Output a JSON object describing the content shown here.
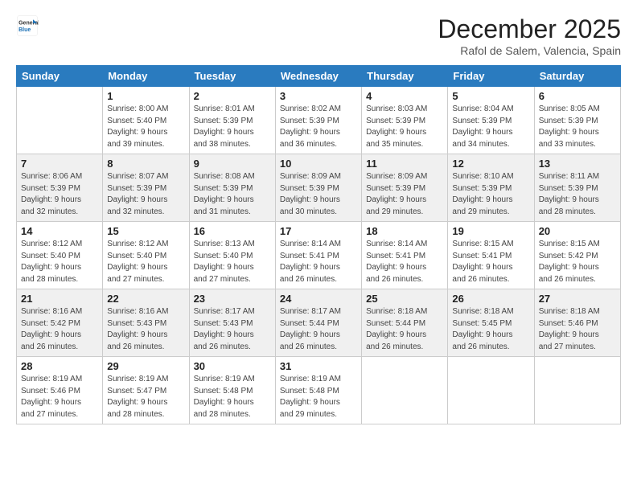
{
  "logo": {
    "line1": "General",
    "line2": "Blue"
  },
  "title": "December 2025",
  "subtitle": "Rafol de Salem, Valencia, Spain",
  "weekdays": [
    "Sunday",
    "Monday",
    "Tuesday",
    "Wednesday",
    "Thursday",
    "Friday",
    "Saturday"
  ],
  "weeks": [
    [
      {
        "day": "",
        "info": ""
      },
      {
        "day": "1",
        "info": "Sunrise: 8:00 AM\nSunset: 5:40 PM\nDaylight: 9 hours\nand 39 minutes."
      },
      {
        "day": "2",
        "info": "Sunrise: 8:01 AM\nSunset: 5:39 PM\nDaylight: 9 hours\nand 38 minutes."
      },
      {
        "day": "3",
        "info": "Sunrise: 8:02 AM\nSunset: 5:39 PM\nDaylight: 9 hours\nand 36 minutes."
      },
      {
        "day": "4",
        "info": "Sunrise: 8:03 AM\nSunset: 5:39 PM\nDaylight: 9 hours\nand 35 minutes."
      },
      {
        "day": "5",
        "info": "Sunrise: 8:04 AM\nSunset: 5:39 PM\nDaylight: 9 hours\nand 34 minutes."
      },
      {
        "day": "6",
        "info": "Sunrise: 8:05 AM\nSunset: 5:39 PM\nDaylight: 9 hours\nand 33 minutes."
      }
    ],
    [
      {
        "day": "7",
        "info": "Sunrise: 8:06 AM\nSunset: 5:39 PM\nDaylight: 9 hours\nand 32 minutes."
      },
      {
        "day": "8",
        "info": "Sunrise: 8:07 AM\nSunset: 5:39 PM\nDaylight: 9 hours\nand 32 minutes."
      },
      {
        "day": "9",
        "info": "Sunrise: 8:08 AM\nSunset: 5:39 PM\nDaylight: 9 hours\nand 31 minutes."
      },
      {
        "day": "10",
        "info": "Sunrise: 8:09 AM\nSunset: 5:39 PM\nDaylight: 9 hours\nand 30 minutes."
      },
      {
        "day": "11",
        "info": "Sunrise: 8:09 AM\nSunset: 5:39 PM\nDaylight: 9 hours\nand 29 minutes."
      },
      {
        "day": "12",
        "info": "Sunrise: 8:10 AM\nSunset: 5:39 PM\nDaylight: 9 hours\nand 29 minutes."
      },
      {
        "day": "13",
        "info": "Sunrise: 8:11 AM\nSunset: 5:39 PM\nDaylight: 9 hours\nand 28 minutes."
      }
    ],
    [
      {
        "day": "14",
        "info": "Sunrise: 8:12 AM\nSunset: 5:40 PM\nDaylight: 9 hours\nand 28 minutes."
      },
      {
        "day": "15",
        "info": "Sunrise: 8:12 AM\nSunset: 5:40 PM\nDaylight: 9 hours\nand 27 minutes."
      },
      {
        "day": "16",
        "info": "Sunrise: 8:13 AM\nSunset: 5:40 PM\nDaylight: 9 hours\nand 27 minutes."
      },
      {
        "day": "17",
        "info": "Sunrise: 8:14 AM\nSunset: 5:41 PM\nDaylight: 9 hours\nand 26 minutes."
      },
      {
        "day": "18",
        "info": "Sunrise: 8:14 AM\nSunset: 5:41 PM\nDaylight: 9 hours\nand 26 minutes."
      },
      {
        "day": "19",
        "info": "Sunrise: 8:15 AM\nSunset: 5:41 PM\nDaylight: 9 hours\nand 26 minutes."
      },
      {
        "day": "20",
        "info": "Sunrise: 8:15 AM\nSunset: 5:42 PM\nDaylight: 9 hours\nand 26 minutes."
      }
    ],
    [
      {
        "day": "21",
        "info": "Sunrise: 8:16 AM\nSunset: 5:42 PM\nDaylight: 9 hours\nand 26 minutes."
      },
      {
        "day": "22",
        "info": "Sunrise: 8:16 AM\nSunset: 5:43 PM\nDaylight: 9 hours\nand 26 minutes."
      },
      {
        "day": "23",
        "info": "Sunrise: 8:17 AM\nSunset: 5:43 PM\nDaylight: 9 hours\nand 26 minutes."
      },
      {
        "day": "24",
        "info": "Sunrise: 8:17 AM\nSunset: 5:44 PM\nDaylight: 9 hours\nand 26 minutes."
      },
      {
        "day": "25",
        "info": "Sunrise: 8:18 AM\nSunset: 5:44 PM\nDaylight: 9 hours\nand 26 minutes."
      },
      {
        "day": "26",
        "info": "Sunrise: 8:18 AM\nSunset: 5:45 PM\nDaylight: 9 hours\nand 26 minutes."
      },
      {
        "day": "27",
        "info": "Sunrise: 8:18 AM\nSunset: 5:46 PM\nDaylight: 9 hours\nand 27 minutes."
      }
    ],
    [
      {
        "day": "28",
        "info": "Sunrise: 8:19 AM\nSunset: 5:46 PM\nDaylight: 9 hours\nand 27 minutes."
      },
      {
        "day": "29",
        "info": "Sunrise: 8:19 AM\nSunset: 5:47 PM\nDaylight: 9 hours\nand 28 minutes."
      },
      {
        "day": "30",
        "info": "Sunrise: 8:19 AM\nSunset: 5:48 PM\nDaylight: 9 hours\nand 28 minutes."
      },
      {
        "day": "31",
        "info": "Sunrise: 8:19 AM\nSunset: 5:48 PM\nDaylight: 9 hours\nand 29 minutes."
      },
      {
        "day": "",
        "info": ""
      },
      {
        "day": "",
        "info": ""
      },
      {
        "day": "",
        "info": ""
      }
    ]
  ]
}
